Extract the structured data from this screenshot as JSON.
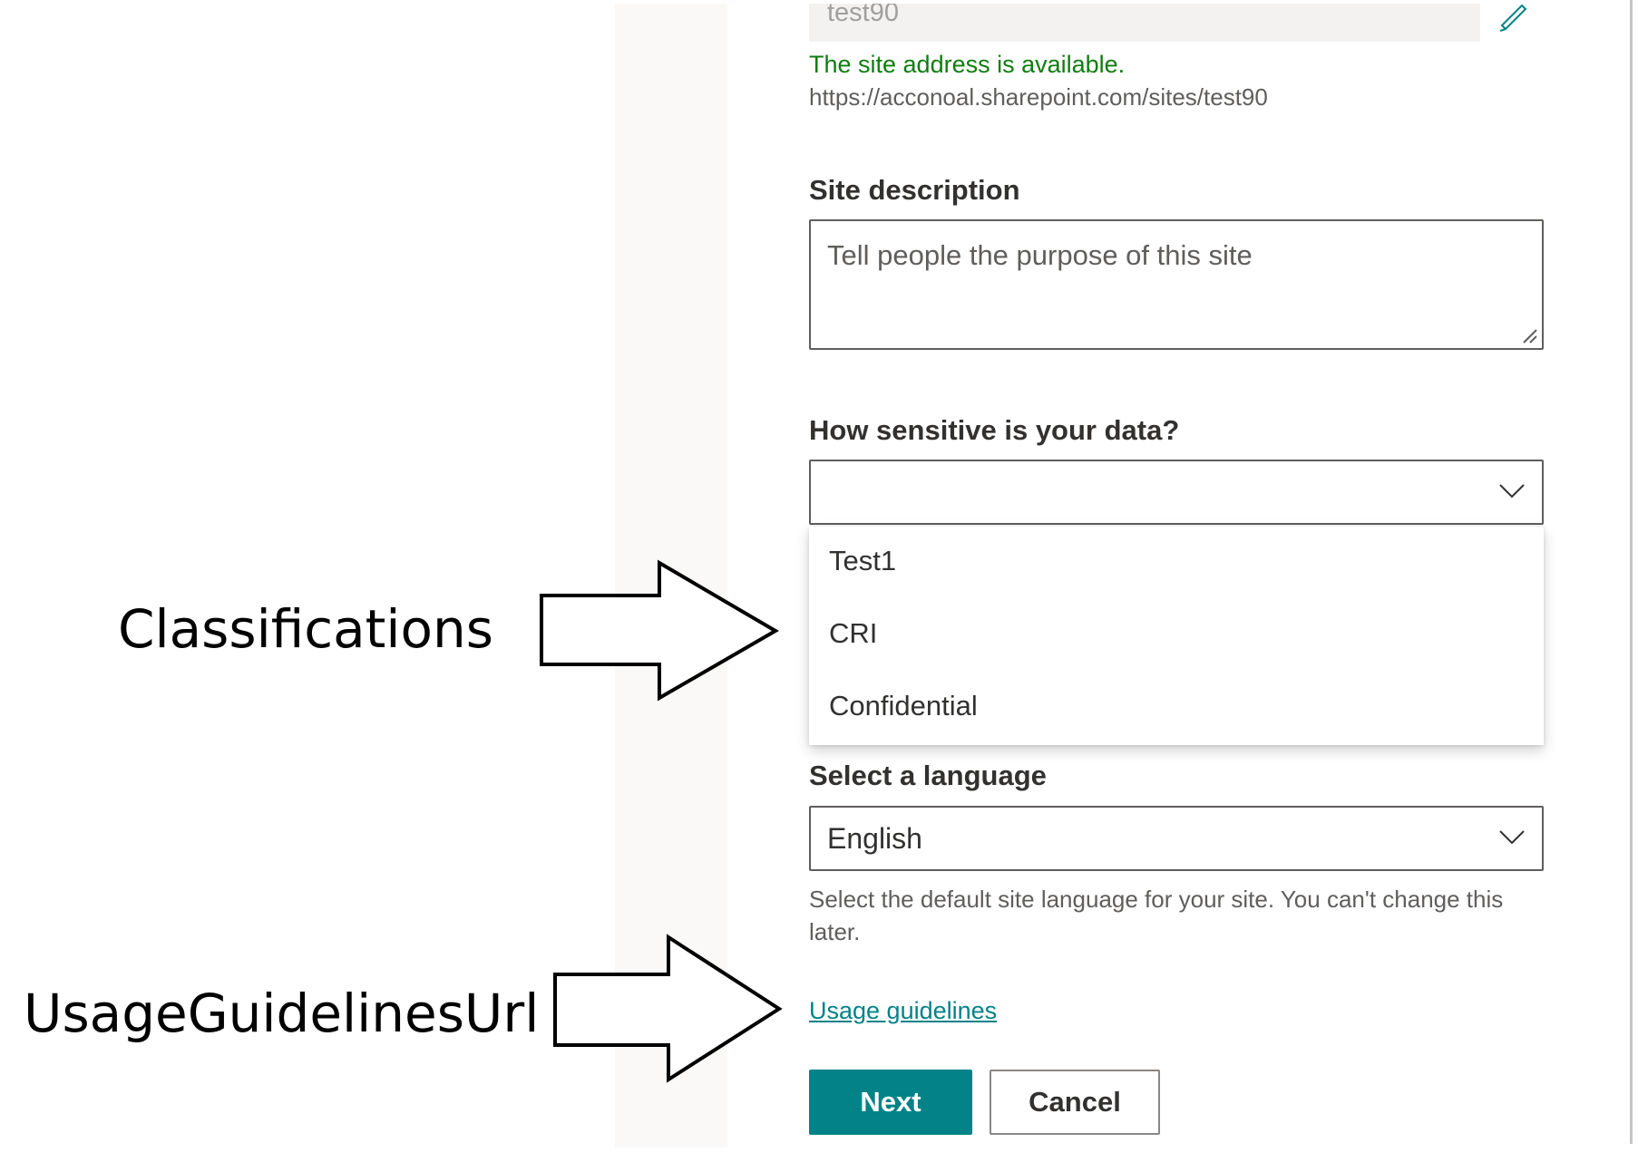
{
  "site_address": {
    "value": "test90",
    "availability_message": "The site address is available.",
    "url": "https://acconoal.sharepoint.com/sites/test90"
  },
  "site_description": {
    "label": "Site description",
    "placeholder": "Tell people the purpose of this site"
  },
  "sensitivity": {
    "label": "How sensitive is your data?",
    "selected": "",
    "options": [
      "Test1",
      "CRI",
      "Confidential"
    ]
  },
  "language": {
    "label": "Select a language",
    "selected": "English",
    "help_text": "Select the default site language for your site. You can't change this later."
  },
  "usage_guidelines": {
    "label": "Usage guidelines"
  },
  "buttons": {
    "next": "Next",
    "cancel": "Cancel"
  },
  "annotations": {
    "classifications": "Classifications",
    "usage_url": "UsageGuidelinesUrl"
  },
  "icons": {
    "edit": "pencil-icon",
    "dropdown": "chevron-down-icon",
    "resize": "resize-handle-icon"
  },
  "colors": {
    "accent": "#038387",
    "success": "#107c10"
  }
}
